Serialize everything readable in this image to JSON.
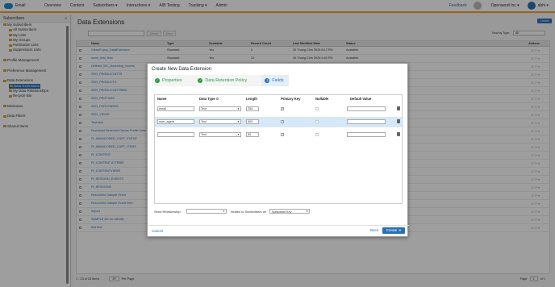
{
  "app": {
    "logo_text": "Email",
    "nav": [
      "Overview",
      "Content",
      "Subscribers ▾",
      "Interactions ▾",
      "A/B Testing",
      "Tracking ▾",
      "Admin"
    ],
    "feedback": "Feedback",
    "org": "Opensend Inc ▾",
    "user": "abhi ▾",
    "accent_color": "#f0a030",
    "brand_color": "#2a70b8"
  },
  "sidebar": {
    "title": "Subscribers",
    "collapse": "«",
    "tree": [
      {
        "label": "My Subscribers",
        "indent": 0
      },
      {
        "label": "All Subscribers",
        "indent": 1
      },
      {
        "label": "My Lists",
        "indent": 1
      },
      {
        "label": "My Groups",
        "indent": 1
      },
      {
        "label": "Publication Lists",
        "indent": 1
      },
      {
        "label": "Suppression Lists",
        "indent": 1
      },
      {
        "label": "",
        "indent": 0
      },
      {
        "label": "Profile Management",
        "indent": 0
      },
      {
        "label": "",
        "indent": 0
      },
      {
        "label": "Preference Management",
        "indent": 0
      },
      {
        "label": "",
        "indent": 0
      },
      {
        "label": "Data Extensions",
        "indent": 0
      },
      {
        "label": "Data Extensions",
        "indent": 1,
        "selected": true
      },
      {
        "label": "My Data Relationships",
        "indent": 1
      },
      {
        "label": "Recycle Bin",
        "indent": 1
      },
      {
        "label": "",
        "indent": 0
      },
      {
        "label": "Measures",
        "indent": 0
      },
      {
        "label": "",
        "indent": 0
      },
      {
        "label": "Data Filters",
        "indent": 0
      },
      {
        "label": "",
        "indent": 0
      },
      {
        "label": "Shared Items",
        "indent": 0
      }
    ]
  },
  "main": {
    "title": "Data Extensions",
    "create_label": "Create",
    "toolbar": {
      "delete": "Delete",
      "move": "Move",
      "view_type_label": "View by Type:",
      "view_type_value": "All"
    },
    "columns": [
      "Name",
      "Type",
      "Sendable",
      "Record Count",
      "Last Modified Date",
      "Status",
      "Actions"
    ],
    "rows": [
      {
        "name": "CleanPopup_DataExtension",
        "type": "Standard",
        "send": "Yes",
        "rec": "0",
        "mod": "30 Thang Chin 2025 8:12 PM",
        "status": "Available"
      },
      {
        "name": "score_test_final",
        "type": "Standard",
        "send": "Yes",
        "rec": "12",
        "mod": "30 Thang Chin 2025 6:40 PM",
        "status": "Available"
      },
      {
        "name": "Deleted_MC_Marketing_Scores",
        "type": "",
        "send": "",
        "rec": "",
        "mod": "",
        "status": ""
      },
      {
        "name": "SSO_PRODUCTATTR",
        "type": "",
        "send": "",
        "rec": "",
        "mod": "",
        "status": ""
      },
      {
        "name": "SSO_PRODUCTS",
        "type": "",
        "send": "",
        "rec": "",
        "mod": "",
        "status": ""
      },
      {
        "name": "SSO_PRODUCTATTRIBS",
        "type": "",
        "send": "",
        "rec": "",
        "mod": "",
        "status": ""
      },
      {
        "name": "SSO_PROFILES",
        "type": "",
        "send": "",
        "rec": "",
        "mod": "",
        "status": ""
      },
      {
        "name": "SSO_PURCHASES",
        "type": "",
        "send": "",
        "rec": "",
        "mod": "",
        "status": ""
      },
      {
        "name": "SSO_VIEWS",
        "type": "",
        "send": "",
        "rec": "",
        "mod": "",
        "status": ""
      },
      {
        "name": "Test new",
        "type": "",
        "send": "",
        "rec": "",
        "mod": "",
        "status": ""
      },
      {
        "name": "Download Reserved Device Profile Data",
        "type": "",
        "send": "",
        "rec": "",
        "mod": "",
        "status": ""
      },
      {
        "name": "PI_ABANDONED_CART_EVENT",
        "type": "",
        "send": "",
        "rec": "",
        "mod": "",
        "status": ""
      },
      {
        "name": "PI_ABANDONED_CART_ITEMS",
        "type": "",
        "send": "",
        "rec": "",
        "mod": "",
        "status": ""
      },
      {
        "name": "PI_CONTENT",
        "type": "",
        "send": "",
        "rec": "",
        "mod": "",
        "status": ""
      },
      {
        "name": "PI_CONTENT ATTRIBS",
        "type": "",
        "send": "",
        "rec": "",
        "mod": "",
        "status": ""
      },
      {
        "name": "PI_CONTENTVIEWS",
        "type": "",
        "send": "",
        "rec": "",
        "mod": "",
        "status": ""
      },
      {
        "name": "PI_SESSION_EVENTS",
        "type": "",
        "send": "",
        "rec": "",
        "mod": "",
        "status": ""
      },
      {
        "name": "PI_SESSIONS",
        "type": "",
        "send": "",
        "rec": "",
        "mod": "",
        "status": ""
      },
      {
        "name": "Recovered Sample Event",
        "type": "",
        "send": "",
        "rec": "",
        "mod": "",
        "status": ""
      },
      {
        "name": "Recovered Sample Event Item",
        "type": "",
        "send": "",
        "rec": "",
        "mod": "",
        "status": ""
      },
      {
        "name": "Import",
        "type": "",
        "send": "",
        "rec": "",
        "mod": "",
        "status": ""
      },
      {
        "name": "SAMPLE DE for Identify",
        "type": "",
        "send": "",
        "rec": "",
        "mod": "",
        "status": ""
      },
      {
        "name": "test test",
        "type": "",
        "send": "",
        "rec": "",
        "mod": "",
        "status": ""
      }
    ],
    "row_actions": "⚖ ⚲ ▾",
    "footer": {
      "range": "1 - 23 of 23 items",
      "per_page_value": "25",
      "per_page_label": "Per Page",
      "page_label": "Page",
      "page_value": "1",
      "of": "of 1"
    }
  },
  "modal": {
    "title": "Create New Data Extension",
    "steps": [
      {
        "label": "Properties",
        "state": "done",
        "mark": "✓"
      },
      {
        "label": "Data Retention Policy",
        "state": "done",
        "mark": "✓"
      },
      {
        "label": "Fields",
        "state": "active",
        "mark": "3"
      }
    ],
    "columns": {
      "name": "Name",
      "data_type": "Data Type",
      "length": "Length",
      "primary_key": "Primary Key",
      "nullable": "Nullable",
      "default": "Default Value"
    },
    "fields": [
      {
        "name": "email",
        "type": "Text",
        "length": "254",
        "pk": true,
        "nullable": false,
        "default": ""
      },
      {
        "name": "user_agent",
        "type": "Text",
        "length": "500",
        "pk": false,
        "nullable": false,
        "default": "",
        "selected": true
      },
      {
        "name": "",
        "type": "Text",
        "length": "50",
        "pk": false,
        "nullable": false,
        "default": ""
      }
    ],
    "send_rel": {
      "label": "Send Relationship:",
      "field_value": "",
      "mid": "relates to Subscribers on",
      "sub_value": "Subscriber Key"
    },
    "cancel": "Cancel",
    "back": "Back",
    "create": "Create ➔"
  }
}
